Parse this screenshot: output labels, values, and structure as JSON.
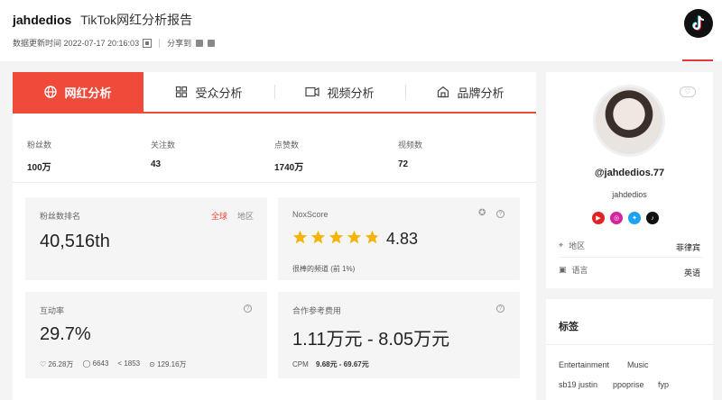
{
  "header": {
    "username": "jahdedios",
    "report_title": "TikTok网红分析报告",
    "updated_label": "数据更新时间 2022-07-17 20:16:03",
    "share_label": "分享到"
  },
  "tabs": [
    {
      "label": "网红分析",
      "icon": "globe-icon",
      "active": true
    },
    {
      "label": "受众分析",
      "icon": "audience-icon",
      "active": false
    },
    {
      "label": "视频分析",
      "icon": "video-icon",
      "active": false
    },
    {
      "label": "品牌分析",
      "icon": "store-icon",
      "active": false
    }
  ],
  "stats": [
    {
      "label": "粉丝数",
      "value": "100万"
    },
    {
      "label": "关注数",
      "value": "43"
    },
    {
      "label": "点赞数",
      "value": "1740万"
    },
    {
      "label": "视频数",
      "value": "72"
    }
  ],
  "rank_card": {
    "title": "粉丝数排名",
    "global": "全球",
    "region": "地区",
    "value": "40,516th"
  },
  "nox_card": {
    "title": "NoxScore",
    "score": "4.83",
    "rating": 4.83,
    "desc": "很棒的频道 (前 1%)"
  },
  "engagement_card": {
    "title": "互动率",
    "value": "29.7%",
    "likes": "26.28万",
    "comments": "6643",
    "shares": "1853",
    "views": "129.16万"
  },
  "cost_card": {
    "title": "合作参考费用",
    "value": "1.11万元 - 8.05万元",
    "cpm_label": "CPM",
    "cpm_value": "9.68元 - 69.67元"
  },
  "profile": {
    "handle": "@jahdedios.77",
    "nickname": "jahdedios",
    "region_label": "地区",
    "region_value": "菲律宾",
    "language_label": "语言",
    "language_value": "英语"
  },
  "tags": {
    "title": "标签",
    "items": [
      "Entertainment",
      "Music",
      "sb19 justin",
      "ppoprise",
      "fyp"
    ]
  },
  "colors": {
    "accent": "#f04a3a",
    "star": "#f5b400"
  }
}
